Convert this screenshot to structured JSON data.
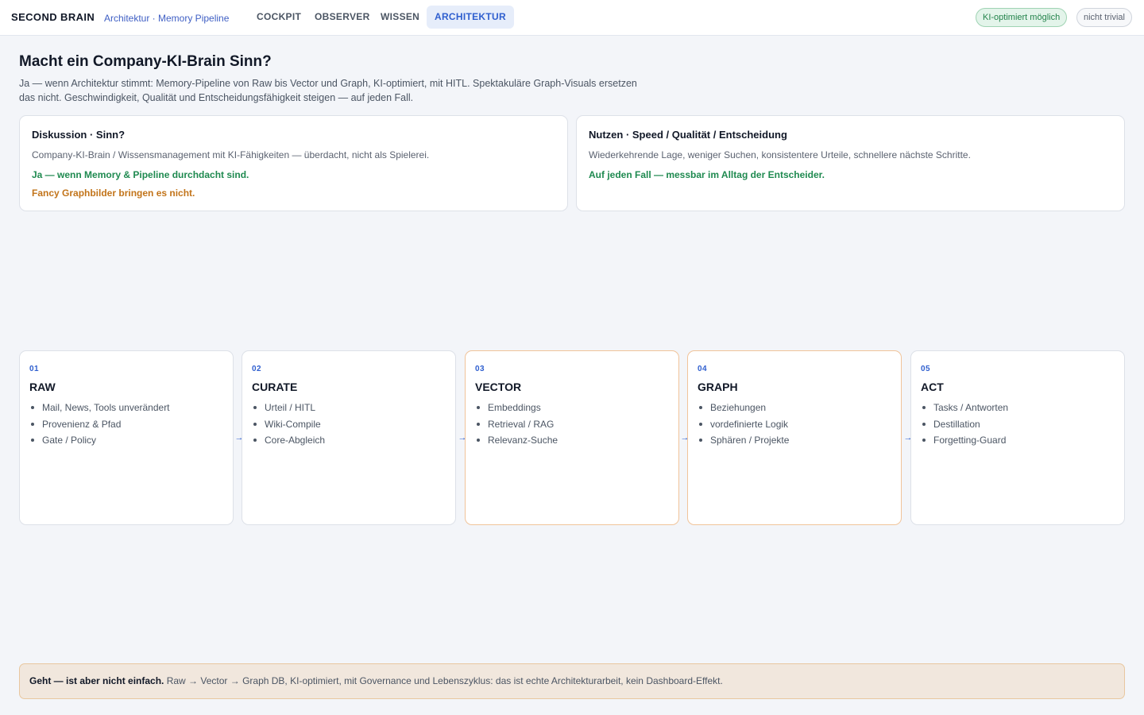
{
  "header": {
    "brand": "SECOND BRAIN",
    "subtitle": "Architektur · Memory Pipeline",
    "tabs": [
      {
        "label": "COCKPIT",
        "active": false
      },
      {
        "label": "OBSERVER",
        "active": false
      },
      {
        "label": "WISSEN",
        "active": false
      },
      {
        "label": "ARCHITEKTUR",
        "active": true
      }
    ],
    "badges": [
      {
        "label": "KI-optimiert möglich",
        "color": "#23834b"
      },
      {
        "label": "nicht trivial",
        "color": "#5b6270"
      }
    ]
  },
  "main": {
    "title": "Macht ein Company-KI-Brain Sinn?",
    "intro": "Ja — wenn Architektur stimmt: Memory-Pipeline von Raw bis Vector und Graph, KI-optimiert, mit HITL. Spektakuläre Graph-Visuals ersetzen das nicht. Geschwindigkeit, Qualität und Entscheidungsfähigkeit steigen — auf jeden Fall.",
    "cards": [
      {
        "title": "Diskussion · Sinn?",
        "desc": "Company-KI-Brain / Wissensmanagement mit KI-Fähigkeiten — überdacht, nicht als Spielerei.",
        "positive": "Ja — wenn Memory & Pipeline durchdacht sind.",
        "warning": "Fancy Graphbilder bringen es nicht."
      },
      {
        "title": "Nutzen · Speed / Qualität / Entscheidung",
        "desc": "Wiederkehrende Lage, weniger Suchen, konsistentere Urteile, schnellere nächste Schritte.",
        "positive": "Auf jeden Fall — messbar im Alltag der Entscheider."
      }
    ],
    "pipeline": [
      {
        "num": "01",
        "title": "RAW",
        "items": [
          "Mail, News, Tools unverändert",
          "Provenienz & Pfad",
          "Gate / Policy"
        ]
      },
      {
        "num": "02",
        "title": "CURATE",
        "items": [
          "Urteil / HITL",
          "Wiki-Compile",
          "Core-Abgleich"
        ]
      },
      {
        "num": "03",
        "title": "VECTOR",
        "items": [
          "Embeddings",
          "Retrieval / RAG",
          "Relevanz-Suche"
        ]
      },
      {
        "num": "04",
        "title": "GRAPH",
        "items": [
          "Beziehungen",
          "vordefinierte Logik",
          "Sphären / Projekte"
        ]
      },
      {
        "num": "05",
        "title": "ACT",
        "items": [
          "Tasks / Antworten",
          "Destillation",
          "Forgetting-Guard"
        ]
      }
    ],
    "arrow_glyph": "→",
    "footer": {
      "bold": "Geht — ist aber nicht einfach.",
      "text": "Raw → Vector → Graph DB, KI-optimiert, mit Governance und Lebenszyklus: das ist echte Architekturarbeit, kein Dashboard-Effekt."
    }
  }
}
